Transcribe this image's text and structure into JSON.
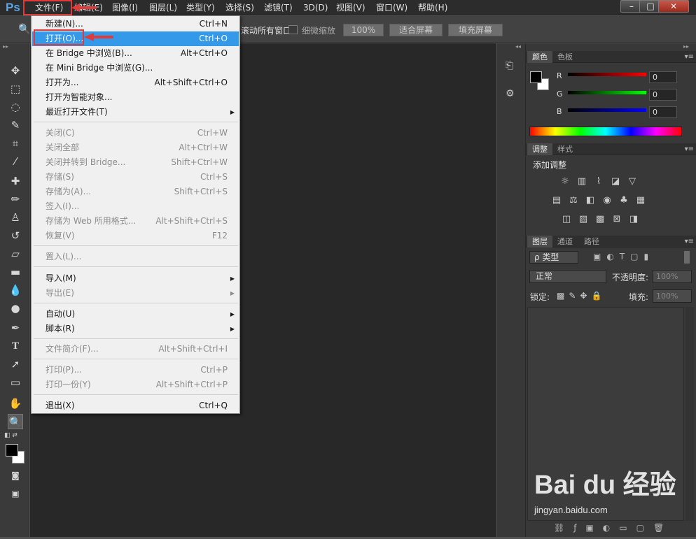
{
  "app": {
    "logo": "Ps"
  },
  "menubar": {
    "items": [
      "文件(F)",
      "编辑(E)",
      "图像(I)",
      "图层(L)",
      "类型(Y)",
      "选择(S)",
      "滤镜(T)",
      "3D(D)",
      "视图(V)",
      "窗口(W)",
      "帮助(H)"
    ],
    "window_controls": {
      "minimize": "–",
      "restore": "□",
      "close": "✕"
    }
  },
  "options": {
    "all_windows_label": "滚动所有窗口",
    "fine_zoom_label": "细微缩放",
    "zoom_value": "100%",
    "fit_screen": "适合屏幕",
    "fill_screen": "填充屏幕"
  },
  "file_menu": {
    "items": [
      {
        "label": "新建(N)...",
        "shortcut": "Ctrl+N",
        "enabled": true
      },
      {
        "label": "打开(O)...",
        "shortcut": "Ctrl+O",
        "enabled": true,
        "highlighted": true
      },
      {
        "label": "在 Bridge 中浏览(B)...",
        "shortcut": "Alt+Ctrl+O",
        "enabled": true
      },
      {
        "label": "在 Mini Bridge 中浏览(G)...",
        "shortcut": "",
        "enabled": true
      },
      {
        "label": "打开为...",
        "shortcut": "Alt+Shift+Ctrl+O",
        "enabled": true
      },
      {
        "label": "打开为智能对象...",
        "shortcut": "",
        "enabled": true
      },
      {
        "label": "最近打开文件(T)",
        "shortcut": "",
        "enabled": true,
        "submenu": true
      },
      {
        "label": "关闭(C)",
        "shortcut": "Ctrl+W",
        "enabled": false
      },
      {
        "label": "关闭全部",
        "shortcut": "Alt+Ctrl+W",
        "enabled": false
      },
      {
        "label": "关闭并转到 Bridge...",
        "shortcut": "Shift+Ctrl+W",
        "enabled": false
      },
      {
        "label": "存储(S)",
        "shortcut": "Ctrl+S",
        "enabled": false
      },
      {
        "label": "存储为(A)...",
        "shortcut": "Shift+Ctrl+S",
        "enabled": false
      },
      {
        "label": "签入(I)...",
        "shortcut": "",
        "enabled": false
      },
      {
        "label": "存储为 Web 所用格式...",
        "shortcut": "Alt+Shift+Ctrl+S",
        "enabled": false
      },
      {
        "label": "恢复(V)",
        "shortcut": "F12",
        "enabled": false
      },
      {
        "label": "置入(L)...",
        "shortcut": "",
        "enabled": false
      },
      {
        "label": "导入(M)",
        "shortcut": "",
        "enabled": true,
        "submenu": true
      },
      {
        "label": "导出(E)",
        "shortcut": "",
        "enabled": false,
        "submenu": true
      },
      {
        "label": "自动(U)",
        "shortcut": "",
        "enabled": true,
        "submenu": true
      },
      {
        "label": "脚本(R)",
        "shortcut": "",
        "enabled": true,
        "submenu": true
      },
      {
        "label": "文件简介(F)...",
        "shortcut": "Alt+Shift+Ctrl+I",
        "enabled": false
      },
      {
        "label": "打印(P)...",
        "shortcut": "Ctrl+P",
        "enabled": false
      },
      {
        "label": "打印一份(Y)",
        "shortcut": "Alt+Shift+Ctrl+P",
        "enabled": false
      },
      {
        "label": "退出(X)",
        "shortcut": "Ctrl+Q",
        "enabled": true
      }
    ]
  },
  "color_panel": {
    "tabs": [
      "颜色",
      "色板"
    ],
    "r_label": "R",
    "g_label": "G",
    "b_label": "B",
    "r_value": "0",
    "g_value": "0",
    "b_value": "0"
  },
  "adjust_panel": {
    "tabs": [
      "调整",
      "样式"
    ],
    "title": "添加调整"
  },
  "layers_panel": {
    "tabs": [
      "图层",
      "通道",
      "路径"
    ],
    "kind_filter": "ρ 类型",
    "blend_mode": "正常",
    "opacity_label": "不透明度:",
    "opacity_value": "100%",
    "lock_label": "锁定:",
    "fill_label": "填充:",
    "fill_value": "100%"
  },
  "watermark": {
    "brand": "Bai du 经验",
    "url": "jingyan.baidu.com"
  },
  "colors": {
    "highlight": "#3399e8",
    "annotation": "#e03b3b",
    "logo": "#5aa6e6"
  }
}
